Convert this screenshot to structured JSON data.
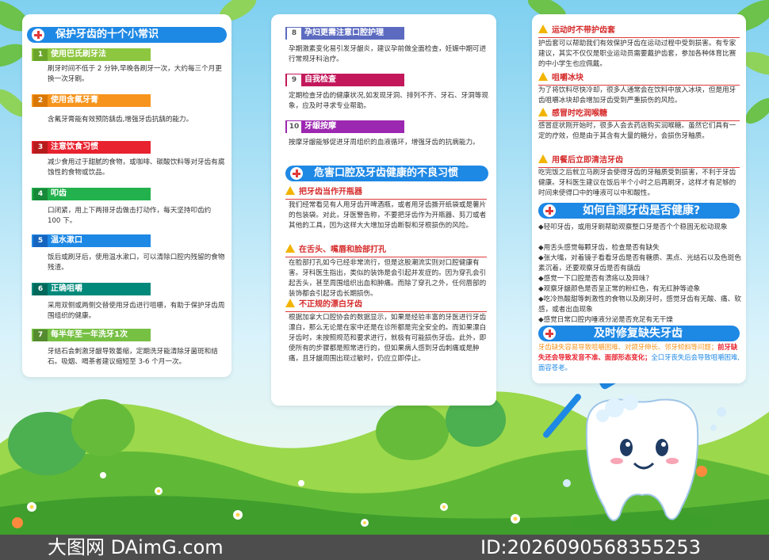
{
  "panel1": {
    "title": "保护牙齿的十个小常识",
    "tips": [
      {
        "num": "1",
        "label": "使用巴氏刷牙法",
        "color": "#8dc63f",
        "text": "刷牙时间不低于 2 分钟,早晚各刷牙一次，大约每三个月更换一次牙刷。"
      },
      {
        "num": "2",
        "label": "使用含氟牙膏",
        "color": "#f7941d",
        "text": "含氟牙膏能有效预防龋齿,增强牙齿抗龋的能力。"
      },
      {
        "num": "3",
        "label": "注意饮食习惯",
        "color": "#e8222f",
        "text": "减少食用过于甜腻的食物，或咖啡、碳酸饮料等对牙齿有腐蚀性的食物或饮品。"
      },
      {
        "num": "4",
        "label": "叩齿",
        "color": "#23b14d",
        "text": "口闭紧，用上下两排牙齿做击打动作，每天坚持叩齿约 100 下。"
      },
      {
        "num": "5",
        "label": "温水漱口",
        "color": "#1e88e5",
        "text": "饭后或刷牙后，使用温水漱口，可以清除口腔内残留的食物残渣。"
      },
      {
        "num": "6",
        "label": "正确咀嚼",
        "color": "#00897b",
        "text": "采用双侧或两侧交替使用牙齿进行咀嚼，有助于保护牙齿周围组织的健康。"
      },
      {
        "num": "7",
        "label": "每半年至一年洗牙1次",
        "color": "#76c043",
        "text": "牙结石会刺激牙龈导致萎缩，定期洗牙能清除牙菌斑和结石。吸烟、喝茶者建议缩短至 3-6 个月一次。"
      }
    ]
  },
  "panel2": {
    "tips": [
      {
        "num": "8",
        "label": "孕妇更需注意口腔护理",
        "color": "#5c6bc0",
        "text": "孕期激素变化易引发牙龈炎，建议孕前做全面检查，妊娠中期可进行常规牙科治疗。"
      },
      {
        "num": "9",
        "label": "自我检查",
        "color": "#c2185b",
        "text": "定期检查牙齿的健康状况,如发现牙洞、排列不齐、牙石、牙洞等现象，应及时寻求专业帮助。"
      },
      {
        "num": "10",
        "label": "牙龈按摩",
        "color": "#9c27b0",
        "text": "按摩牙龈能够促进牙周组织的血液循环，增强牙齿的抗病能力。"
      }
    ],
    "section_title": "危害口腔及牙齿健康的不良习惯",
    "habits": [
      {
        "title": "把牙齿当作开瓶器",
        "text": "我们经常看见有人用牙齿开啤酒瓶，或者用牙齿撕开纸袋或是薯片的包装袋。对此，牙医警告称，不要把牙齿作为开瓶器、剪刀或者其他的工具，因为这样大大增加牙齿断裂和牙根损伤的风险。"
      },
      {
        "title": "在舌头、嘴唇和脸部打孔",
        "text": "在脸部打孔如今已经非常流行，但是这股潮流实则对口腔健康有害。牙科医生指出，类似的装饰是会引起并发症的。因为穿孔会引起舌头，甚至周围组织出血和肿痛。而除了穿孔之外，任何唇部的装饰都会引起牙齿长期损伤。"
      },
      {
        "title": "不正规的漂白牙齿",
        "text": "根据加拿大口腔协会的数据显示，如果是经验丰富的牙医进行牙齿漂白，那么无论是在家中还是在诊所都是完全安全的。而如果漂白牙齿时，未按照规范和要求进行，就极有可能损伤牙齿。此外，即使所有的步骤都是照常进行的，但如果病人感到牙齿刺痛或是肿痛，且牙龈周围出现过敏时，仍应立即停止。"
      }
    ]
  },
  "panel3": {
    "habits": [
      {
        "title": "运动时不带护齿套",
        "text": "护齿套可以帮助我们有效保护牙齿在运动过程中受到损害。有专家建议，其实不仅仅是职业运动员需要戴护齿套，参加各种体育比赛的中小学生也应佩戴。"
      },
      {
        "title": "咀嚼冰块",
        "text": "为了将饮料尽快冷却，很多人通常会在饮料中放入冰块，但是用牙齿咀嚼冰块却会增加牙齿受到严重损伤的风险。"
      },
      {
        "title": "感冒时吃润喉糖",
        "text": "感冒症状刚开始时，很多人会去药店购买润喉糖。虽然它们具有一定的疗效，但是由于其含有大量的糖分，会损伤牙釉质。"
      },
      {
        "title": "用餐后立即清洁牙齿",
        "text": "吃完饭之后就立马刷牙会使得牙齿的牙釉质受到损害，不利于牙齿健康。牙科医生建议在饭后半个小时之后再刷牙，这样才有足够的时间来使得口中的唾液可以中和酸性。"
      }
    ],
    "selfcheck_title": "如何自测牙齿是否健康?",
    "selfcheck_intro": "◆轻叩牙齿，或用牙刷帮助观察整口牙是否个个稳固无松动现象",
    "selfcheck_items": [
      "◆用舌头感觉每颗牙齿，检查是否有缺失",
      "◆张大嘴，对着镜子看看牙齿是否有糖质、黑点、光结石以及色斑色素沉着，还要观察牙齿是否有龋齿",
      "◆感觉一下口腔是否有溃疡以及异味？",
      "◆观察牙龈颜色是否呈正常的粉红色，有无红肿等迹象",
      "◆吃冷热酸甜等刺激性的食物以及刷牙时，感觉牙齿有无酸、痛、软感，或者出血现象",
      "◆感觉日常口腔内唾液分泌是否充足有无干燥"
    ],
    "repair_title": "及时修复缺失牙齿",
    "repair_parts": [
      {
        "text": "牙齿缺失容易导致咀嚼困难、对颌牙伸长、邻牙倾斜等问题；",
        "color": "#f7941d"
      },
      {
        "text": "前牙缺失还会导致发音不准、面部形态变化；",
        "color": "#e8222f"
      },
      {
        "text": "全口牙丧失后会导致咀嚼困难,面容苍老。",
        "color": "#1e88e5"
      }
    ]
  },
  "footer": {
    "brand": "大图网 DAimG.com",
    "id_text": "ID:2026090568355253"
  },
  "colors": {
    "header_blue": "#1e88e5",
    "accent_red": "#e03a3a",
    "warn_yellow": "#f2b400"
  }
}
